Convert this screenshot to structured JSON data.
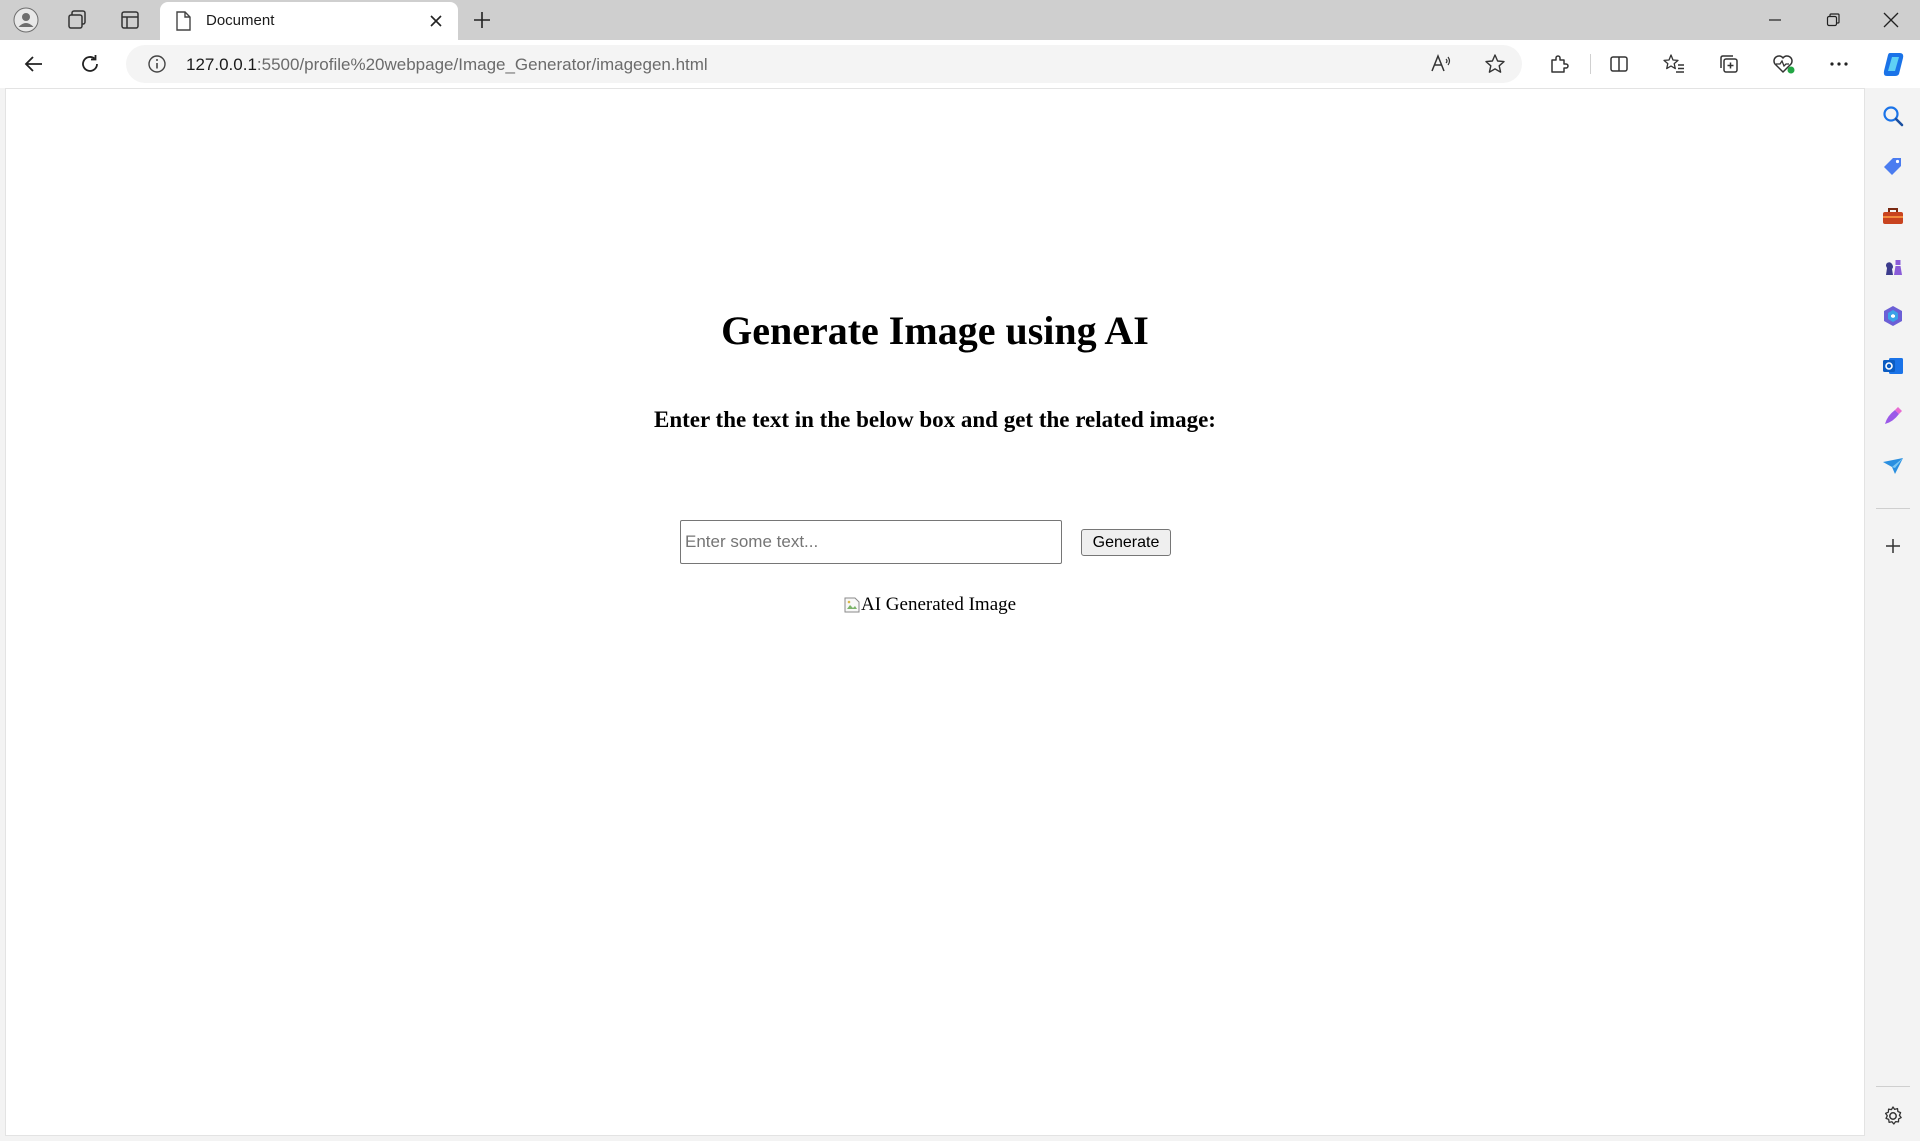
{
  "browser": {
    "tab": {
      "title": "Document"
    },
    "url": {
      "host": "127.0.0.1",
      "path": ":5500/profile%20webpage/Image_Generator/imagegen.html"
    }
  },
  "page": {
    "heading": "Generate Image using AI",
    "subheading": "Enter the text in the below box and get the related image:",
    "input": {
      "placeholder": "Enter some text...",
      "value": ""
    },
    "button_label": "Generate",
    "image_alt": "AI Generated Image"
  },
  "colors": {
    "tabstrip": "#cfcfcf",
    "page_bg": "#ffffff",
    "copilot_blue": "#1a73e8"
  }
}
